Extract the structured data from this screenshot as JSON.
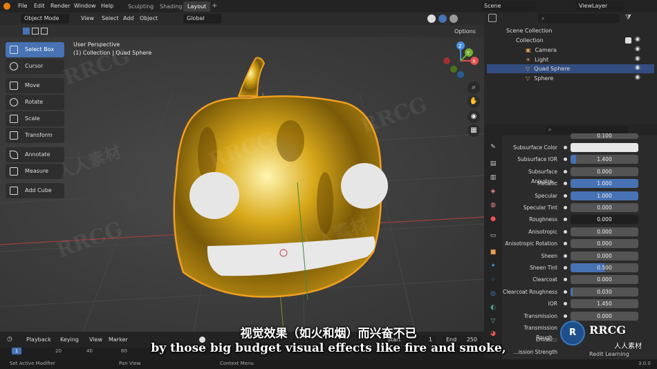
{
  "menus": [
    "File",
    "Edit",
    "Render",
    "Window",
    "Help"
  ],
  "workspaces": {
    "sculpting": "Sculpting",
    "shading": "Shading",
    "layout": "Layout"
  },
  "scene": {
    "label": "Scene",
    "view_layer": "ViewLayer"
  },
  "header": {
    "mode": "Object Mode",
    "view": "View",
    "select": "Select",
    "add": "Add",
    "object": "Object",
    "transform": "Global",
    "options": "Options"
  },
  "viewport": {
    "perspective": "User Perspective",
    "collection_info": "(1) Collection | Quad Sphere"
  },
  "tools": [
    "Select Box",
    "Cursor",
    "Move",
    "Rotate",
    "Scale",
    "Transform",
    "Annotate",
    "Measure",
    "Add Cube"
  ],
  "gizmo": {
    "x": "X",
    "y": "Y",
    "z": "Z"
  },
  "outliner": {
    "scene_collection": "Scene Collection",
    "collection": "Collection",
    "items": [
      "Camera",
      "Light",
      "Quad Sphere",
      "Sphere"
    ]
  },
  "properties": {
    "top_value": "0.100",
    "rows": [
      {
        "label": "Subsurface Color",
        "value": "",
        "fill": 0,
        "color": "#e8e8e8"
      },
      {
        "label": "Subsurface IOR",
        "value": "1.400",
        "fill": 0.08
      },
      {
        "label": "Subsurface Anisotro...",
        "value": "0.000",
        "fill": 0
      },
      {
        "label": "Metallic",
        "value": "1.000",
        "fill": 1
      },
      {
        "label": "Specular",
        "value": "1.000",
        "fill": 1
      },
      {
        "label": "Specular Tint",
        "value": "0.000",
        "fill": 0
      },
      {
        "label": "Roughness",
        "value": "0.000",
        "fill": 0
      },
      {
        "label": "Anisotropic",
        "value": "0.000",
        "fill": 0
      },
      {
        "label": "Anisotropic Rotation",
        "value": "0.000",
        "fill": 0
      },
      {
        "label": "Sheen",
        "value": "0.000",
        "fill": 0
      },
      {
        "label": "Sheen Tint",
        "value": "0.500",
        "fill": 0.5
      },
      {
        "label": "Clearcoat",
        "value": "0.000",
        "fill": 0
      },
      {
        "label": "Clearcoat Roughness",
        "value": "0.030",
        "fill": 0.03
      },
      {
        "label": "IOR",
        "value": "1.450",
        "fill": 0
      },
      {
        "label": "Transmission",
        "value": "0.000",
        "fill": 0
      },
      {
        "label": "Transmission Rough...",
        "value": "",
        "fill": 0
      },
      {
        "label": "Emissi...",
        "value": "",
        "fill": 0
      },
      {
        "label": "...ission Strength",
        "value": "",
        "fill": 0
      }
    ]
  },
  "timeline": {
    "playback": "Playback",
    "keying": "Keying",
    "view": "View",
    "marker": "Marker",
    "start_label": "Start",
    "start": "1",
    "end_label": "End",
    "end": "250",
    "frames": [
      "1",
      "20",
      "40",
      "60"
    ]
  },
  "status": {
    "left": "Set Active Modifier",
    "pan": "Pan View",
    "context": "Context Menu",
    "version": "3.0.0"
  },
  "subtitle": {
    "cn": "视觉效果（如火和烟）而兴奋不已",
    "en": "by those big budget visual effects like fire and smoke,"
  },
  "watermark": {
    "logo": "RRCG",
    "brand": "人人素材",
    "sub": "Redit Learning"
  },
  "colors": {
    "accent": "#4772b3",
    "gold": "#d4a017",
    "outline": "#f0a020"
  }
}
